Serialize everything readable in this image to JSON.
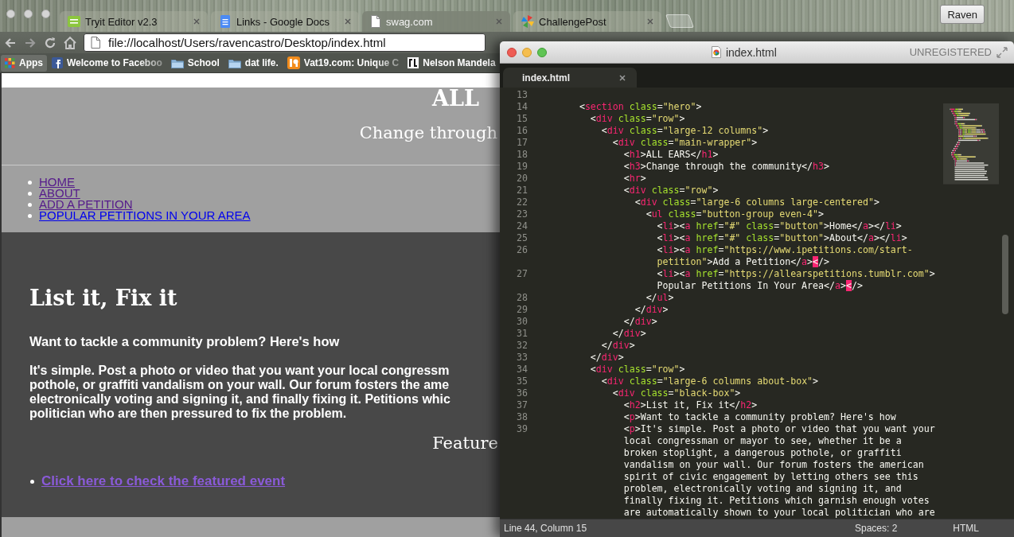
{
  "browser": {
    "tabs": [
      {
        "title": "Tryit Editor v2.3",
        "selected": false
      },
      {
        "title": "Links - Google Docs",
        "selected": false
      },
      {
        "title": "swag.com",
        "selected": true
      },
      {
        "title": "ChallengePost",
        "selected": false
      }
    ],
    "profile": "Raven",
    "address": "file://localhost/Users/ravencastro/Desktop/index.html",
    "bookmarks": [
      {
        "label": "Apps",
        "faded": false
      },
      {
        "label": "Welcome to Faceboo",
        "faded": true
      },
      {
        "label": "School",
        "faded": false
      },
      {
        "label": "dat life.",
        "faded": false
      },
      {
        "label": "Vat19.com: Unique C",
        "faded": true
      },
      {
        "label": "Nelson Mandela",
        "faded": false
      }
    ],
    "page": {
      "hero_title": "ALL",
      "hero_subtitle": "Change through",
      "nav": [
        {
          "label": "HOME",
          "visited": true
        },
        {
          "label": "ABOUT",
          "visited": true
        },
        {
          "label": "ADD A PETITION",
          "visited": true
        },
        {
          "label": "POPULAR PETITIONS IN YOUR AREA",
          "visited": false
        }
      ],
      "section_title": "List it, Fix it",
      "intro": "Want to tackle a community problem? Here's how",
      "paragraph_lines": [
        "It's simple. Post a photo or video that you want your local congressm",
        "pothole, or graffiti vandalism on your wall. Our forum fosters the ame",
        "electronically voting and signing it, and finally fixing it. Petitions whic",
        "politician who are then pressured to fix the problem."
      ],
      "featured_heading": "Feature",
      "featured_links": [
        {
          "label": "Click here to check the featured event",
          "visited": true
        }
      ]
    }
  },
  "editor": {
    "title": "index.html",
    "license": "UNREGISTERED",
    "tabs": [
      {
        "title": "index.html",
        "selected": true
      }
    ],
    "code_lines": [
      {
        "number": "13"
      },
      {
        "number": "14",
        "tokens": [
          {
            "kind": "text",
            "text": "      <"
          },
          {
            "kind": "tag",
            "text": "section"
          },
          {
            "kind": "attr",
            "text": " class"
          },
          {
            "kind": "text",
            "text": "="
          },
          {
            "kind": "string",
            "text": "\"hero\""
          },
          {
            "kind": "text",
            "text": ">"
          }
        ]
      },
      {
        "number": "15",
        "tokens": [
          {
            "kind": "text",
            "text": "        <"
          },
          {
            "kind": "tag",
            "text": "div"
          },
          {
            "kind": "attr",
            "text": " class"
          },
          {
            "kind": "text",
            "text": "="
          },
          {
            "kind": "string",
            "text": "\"row\""
          },
          {
            "kind": "text",
            "text": ">"
          }
        ]
      },
      {
        "number": "16",
        "tokens": [
          {
            "kind": "text",
            "text": "          <"
          },
          {
            "kind": "tag",
            "text": "div"
          },
          {
            "kind": "attr",
            "text": " class"
          },
          {
            "kind": "text",
            "text": "="
          },
          {
            "kind": "string",
            "text": "\"large-12 columns\""
          },
          {
            "kind": "text",
            "text": ">"
          }
        ]
      },
      {
        "number": "17",
        "tokens": [
          {
            "kind": "text",
            "text": "            <"
          },
          {
            "kind": "tag",
            "text": "div"
          },
          {
            "kind": "attr",
            "text": " class"
          },
          {
            "kind": "text",
            "text": "="
          },
          {
            "kind": "string",
            "text": "\"main-wrapper\""
          },
          {
            "kind": "text",
            "text": ">"
          }
        ]
      },
      {
        "number": "18",
        "tokens": [
          {
            "kind": "text",
            "text": "              <"
          },
          {
            "kind": "tag",
            "text": "h1"
          },
          {
            "kind": "text",
            "text": ">ALL EARS</"
          },
          {
            "kind": "tag",
            "text": "h1"
          },
          {
            "kind": "text",
            "text": ">"
          }
        ]
      },
      {
        "number": "19",
        "tokens": [
          {
            "kind": "text",
            "text": "              <"
          },
          {
            "kind": "tag",
            "text": "h3"
          },
          {
            "kind": "text",
            "text": ">Change through the community</"
          },
          {
            "kind": "tag",
            "text": "h3"
          },
          {
            "kind": "text",
            "text": ">"
          }
        ]
      },
      {
        "number": "20",
        "tokens": [
          {
            "kind": "text",
            "text": "              <"
          },
          {
            "kind": "tag",
            "text": "hr"
          },
          {
            "kind": "text",
            "text": ">"
          }
        ]
      },
      {
        "number": "21",
        "tokens": [
          {
            "kind": "text",
            "text": "              <"
          },
          {
            "kind": "tag",
            "text": "div"
          },
          {
            "kind": "attr",
            "text": " class"
          },
          {
            "kind": "text",
            "text": "="
          },
          {
            "kind": "string",
            "text": "\"row\""
          },
          {
            "kind": "text",
            "text": ">"
          }
        ]
      },
      {
        "number": "22",
        "tokens": [
          {
            "kind": "text",
            "text": "                <"
          },
          {
            "kind": "tag",
            "text": "div"
          },
          {
            "kind": "attr",
            "text": " class"
          },
          {
            "kind": "text",
            "text": "="
          },
          {
            "kind": "string",
            "text": "\"large-6 columns large-centered\""
          },
          {
            "kind": "text",
            "text": ">"
          }
        ]
      },
      {
        "number": "23",
        "tokens": [
          {
            "kind": "text",
            "text": "                  <"
          },
          {
            "kind": "tag",
            "text": "ul"
          },
          {
            "kind": "attr",
            "text": " class"
          },
          {
            "kind": "text",
            "text": "="
          },
          {
            "kind": "string",
            "text": "\"button-group even-4\""
          },
          {
            "kind": "text",
            "text": ">"
          }
        ]
      },
      {
        "number": "24",
        "tokens": [
          {
            "kind": "text",
            "text": "                    <"
          },
          {
            "kind": "tag",
            "text": "li"
          },
          {
            "kind": "text",
            "text": "><"
          },
          {
            "kind": "tag",
            "text": "a"
          },
          {
            "kind": "attr",
            "text": " href"
          },
          {
            "kind": "text",
            "text": "="
          },
          {
            "kind": "string",
            "text": "\"#\""
          },
          {
            "kind": "attr",
            "text": " class"
          },
          {
            "kind": "text",
            "text": "="
          },
          {
            "kind": "string",
            "text": "\"button\""
          },
          {
            "kind": "text",
            "text": ">Home</"
          },
          {
            "kind": "tag",
            "text": "a"
          },
          {
            "kind": "text",
            "text": "></"
          },
          {
            "kind": "tag",
            "text": "li"
          },
          {
            "kind": "text",
            "text": ">"
          }
        ]
      },
      {
        "number": "25",
        "tokens": [
          {
            "kind": "text",
            "text": "                    <"
          },
          {
            "kind": "tag",
            "text": "li"
          },
          {
            "kind": "text",
            "text": "><"
          },
          {
            "kind": "tag",
            "text": "a"
          },
          {
            "kind": "attr",
            "text": " href"
          },
          {
            "kind": "text",
            "text": "="
          },
          {
            "kind": "string",
            "text": "\"#\""
          },
          {
            "kind": "attr",
            "text": " class"
          },
          {
            "kind": "text",
            "text": "="
          },
          {
            "kind": "string",
            "text": "\"button\""
          },
          {
            "kind": "text",
            "text": ">About</"
          },
          {
            "kind": "tag",
            "text": "a"
          },
          {
            "kind": "text",
            "text": "></"
          },
          {
            "kind": "tag",
            "text": "li"
          },
          {
            "kind": "text",
            "text": ">"
          }
        ]
      },
      {
        "number": "26",
        "tokens": [
          {
            "kind": "text",
            "text": "                    <"
          },
          {
            "kind": "tag",
            "text": "li"
          },
          {
            "kind": "text",
            "text": "><"
          },
          {
            "kind": "tag",
            "text": "a"
          },
          {
            "kind": "attr",
            "text": " href"
          },
          {
            "kind": "text",
            "text": "="
          },
          {
            "kind": "string",
            "text": "\"https://www.ipetitions.com/start-"
          }
        ]
      },
      {
        "tokens": [
          {
            "kind": "string",
            "text": "                    petition\""
          },
          {
            "kind": "text",
            "text": ">Add a Petition</"
          },
          {
            "kind": "tag",
            "text": "a"
          },
          {
            "kind": "text",
            "text": ">"
          },
          {
            "kind": "error",
            "text": "<"
          },
          {
            "kind": "text",
            "text": "/>"
          }
        ]
      },
      {
        "number": "27",
        "tokens": [
          {
            "kind": "text",
            "text": "                    <"
          },
          {
            "kind": "tag",
            "text": "li"
          },
          {
            "kind": "text",
            "text": "><"
          },
          {
            "kind": "tag",
            "text": "a"
          },
          {
            "kind": "attr",
            "text": " href"
          },
          {
            "kind": "text",
            "text": "="
          },
          {
            "kind": "string",
            "text": "\"https://allearspetitions.tumblr.com\""
          },
          {
            "kind": "text",
            "text": ">"
          }
        ]
      },
      {
        "tokens": [
          {
            "kind": "text",
            "text": "                    Popular Petitions In Your Area</"
          },
          {
            "kind": "tag",
            "text": "a"
          },
          {
            "kind": "text",
            "text": ">"
          },
          {
            "kind": "error",
            "text": "<"
          },
          {
            "kind": "text",
            "text": "/>"
          }
        ]
      },
      {
        "number": "28",
        "tokens": [
          {
            "kind": "text",
            "text": "                  </"
          },
          {
            "kind": "tag",
            "text": "ul"
          },
          {
            "kind": "text",
            "text": ">"
          }
        ]
      },
      {
        "number": "29",
        "tokens": [
          {
            "kind": "text",
            "text": "                </"
          },
          {
            "kind": "tag",
            "text": "div"
          },
          {
            "kind": "text",
            "text": ">"
          }
        ]
      },
      {
        "number": "30",
        "tokens": [
          {
            "kind": "text",
            "text": "              </"
          },
          {
            "kind": "tag",
            "text": "div"
          },
          {
            "kind": "text",
            "text": ">"
          }
        ]
      },
      {
        "number": "31",
        "tokens": [
          {
            "kind": "text",
            "text": "            </"
          },
          {
            "kind": "tag",
            "text": "div"
          },
          {
            "kind": "text",
            "text": ">"
          }
        ]
      },
      {
        "number": "32",
        "tokens": [
          {
            "kind": "text",
            "text": "          </"
          },
          {
            "kind": "tag",
            "text": "div"
          },
          {
            "kind": "text",
            "text": ">"
          }
        ]
      },
      {
        "number": "33",
        "tokens": [
          {
            "kind": "text",
            "text": "        </"
          },
          {
            "kind": "tag",
            "text": "div"
          },
          {
            "kind": "text",
            "text": ">"
          }
        ]
      },
      {
        "number": "34",
        "tokens": [
          {
            "kind": "text",
            "text": "        <"
          },
          {
            "kind": "tag",
            "text": "div"
          },
          {
            "kind": "attr",
            "text": " class"
          },
          {
            "kind": "text",
            "text": "="
          },
          {
            "kind": "string",
            "text": "\"row\""
          },
          {
            "kind": "text",
            "text": ">"
          }
        ]
      },
      {
        "number": "35",
        "tokens": [
          {
            "kind": "text",
            "text": "          <"
          },
          {
            "kind": "tag",
            "text": "div"
          },
          {
            "kind": "attr",
            "text": " class"
          },
          {
            "kind": "text",
            "text": "="
          },
          {
            "kind": "string",
            "text": "\"large-6 columns about-box\""
          },
          {
            "kind": "text",
            "text": ">"
          }
        ]
      },
      {
        "number": "36",
        "tokens": [
          {
            "kind": "text",
            "text": "            <"
          },
          {
            "kind": "tag",
            "text": "div"
          },
          {
            "kind": "attr",
            "text": " class"
          },
          {
            "kind": "text",
            "text": "="
          },
          {
            "kind": "string",
            "text": "\"black-box\""
          },
          {
            "kind": "text",
            "text": ">"
          }
        ]
      },
      {
        "number": "37",
        "tokens": [
          {
            "kind": "text",
            "text": "              <"
          },
          {
            "kind": "tag",
            "text": "h2"
          },
          {
            "kind": "text",
            "text": ">List it, Fix it</"
          },
          {
            "kind": "tag",
            "text": "h2"
          },
          {
            "kind": "text",
            "text": ">"
          }
        ]
      },
      {
        "number": "38",
        "tokens": [
          {
            "kind": "text",
            "text": "              <"
          },
          {
            "kind": "tag",
            "text": "p"
          },
          {
            "kind": "text",
            "text": ">Want to tackle a community problem? Here's how"
          }
        ]
      },
      {
        "number": "39",
        "tokens": [
          {
            "kind": "text",
            "text": "              <"
          },
          {
            "kind": "tag",
            "text": "p"
          },
          {
            "kind": "text",
            "text": ">It's simple. Post a photo or video that you want your"
          }
        ]
      },
      {
        "tokens": [
          {
            "kind": "text",
            "text": "              local congressman or mayor to see, whether it be a"
          }
        ]
      },
      {
        "tokens": [
          {
            "kind": "text",
            "text": "              broken stoplight, a dangerous pothole, or graffiti"
          }
        ]
      },
      {
        "tokens": [
          {
            "kind": "text",
            "text": "              vandalism on your wall. Our forum fosters the american"
          }
        ]
      },
      {
        "tokens": [
          {
            "kind": "text",
            "text": "              spirit of civic engagement by letting others see this"
          }
        ]
      },
      {
        "tokens": [
          {
            "kind": "text",
            "text": "              problem, electronically voting and signing it, and"
          }
        ]
      },
      {
        "tokens": [
          {
            "kind": "text",
            "text": "              finally fixing it. Petitions which garnish enough votes"
          }
        ]
      },
      {
        "tokens": [
          {
            "kind": "text",
            "text": "              are automatically shown to your local politician who are"
          }
        ]
      }
    ],
    "status": {
      "position": "Line 44, Column 15",
      "indentation": "Spaces: 2",
      "syntax": "HTML"
    }
  }
}
